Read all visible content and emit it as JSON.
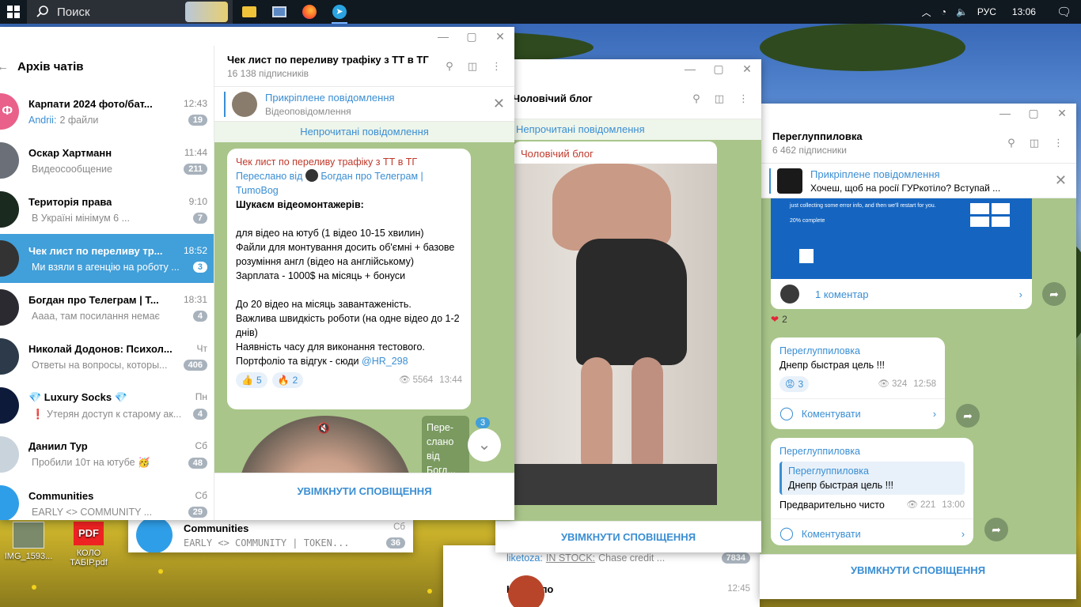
{
  "taskbar": {
    "search_label": "Поиск",
    "lang": "РУС",
    "time": "13:06"
  },
  "desktop_icons": [
    {
      "label": "IMG_1593...",
      "type": "image"
    },
    {
      "label": "КОЛО ТАБІР.pdf",
      "type": "pdf",
      "badge": "PDF"
    }
  ],
  "archive": {
    "title": "Архів чатів",
    "chats": [
      {
        "name": "Карпати 2024 фото/бат...",
        "time": "12:43",
        "preview_sender": "Andrii:",
        "preview": "2 файли",
        "badge": "19",
        "avatar_color": "#e9608a",
        "avatar_letter": "Ф"
      },
      {
        "name": "Оскар Хартманн",
        "time": "11:44",
        "preview": "Видеосообщение",
        "badge": "211",
        "avatar_color": "#6b7078"
      },
      {
        "name": "Територія права",
        "time": "9:10",
        "preview": "В Україні мінімум 6 ...",
        "badge": "7",
        "avatar_color": "#1a2a1e"
      },
      {
        "name": "Чек лист по переливу тр...",
        "time": "18:52",
        "preview": "Ми взяли в агенцію на роботу ...",
        "badge": "3",
        "avatar_color": "#333333",
        "selected": true
      },
      {
        "name": "Богдан про Телеграм | Т...",
        "time": "18:31",
        "preview": "Аааа, там посилання немає",
        "badge": "4",
        "avatar_color": "#2a2a30"
      },
      {
        "name": "Николай Додонов: Психол...",
        "time": "Чт",
        "preview": "Ответы на вопросы, которы...",
        "badge": "406",
        "avatar_color": "#2c3a4a"
      },
      {
        "name": "💎 Luxury Socks 💎",
        "time": "Пн",
        "preview": "❗ Утерян доступ к старому ак...",
        "badge": "4",
        "avatar_color": "#0d1a3a"
      },
      {
        "name": "Даниил Тур",
        "time": "Сб",
        "preview": "Пробили 10т на ютубе 🥳",
        "badge": "48",
        "avatar_color": "#c9d3dc"
      },
      {
        "name": "Communities",
        "time": "Сб",
        "preview": "EARLY <> COMMUNITY ...",
        "badge": "29",
        "avatar_color": "#2f9ee8"
      }
    ]
  },
  "bg_window": {
    "row1_name": "Communities",
    "row1_time": "Сб",
    "row1_preview": "EARLY <> COMMUNITY | TOKEN...",
    "row1_badge": "36",
    "row2_sender": "liketoza:",
    "row2_link": "IN STOCK:",
    "row2_preview": "Chase credit ...",
    "row2_badge": "7834",
    "row3_name": "Настигло",
    "row3_time": "12:45"
  },
  "window1": {
    "title": "Чек лист по переливу трафіку з ТТ в ТГ",
    "subtitle": "16 138 підписників",
    "pinned_title": "Прикріплене повідомлення",
    "pinned_text": "Відеоповідомлення",
    "unread": "Непрочитані повідомлення",
    "msg": {
      "channel": "Чек лист по переливу трафіку з ТТ в ТГ",
      "forwarded_prefix": "Переслано від",
      "forwarded_from": "Богдан про Телеграм | TumoBog",
      "heading": "Шукаєм відеомонтажерів:",
      "lines": [
        "для відео на ютуб (1 відео 10-15 хвилин)",
        "Файли для монтування досить об'ємні + базове розуміння англ (відео на англійському)",
        "Зарплата - 1000$ на місяць + бонуси",
        "До 20 відео на місяць завантаженість.",
        "Важлива швидкість роботи (на одне відео до 1-2 днів)",
        "Наявність часу для виконання тестового.",
        "Портфоліо та відгук - сюди"
      ],
      "handle": "@HR_298",
      "reactions": [
        {
          "emoji": "👍",
          "count": "5"
        },
        {
          "emoji": "🔥",
          "count": "2"
        }
      ],
      "views": "5564",
      "time": "13:44"
    },
    "fwd_stub": "Пере­слано від Богд...",
    "scroll_badge": "3",
    "bottom_button": "УВІМКНУТИ СПОВІЩЕННЯ"
  },
  "window2": {
    "title": "Чоловічий блог",
    "unread": "Непрочитані повідомлення",
    "post_channel": "Чоловічий блог",
    "bottom_button": "УВІМКНУТИ СПОВІЩЕННЯ"
  },
  "window3": {
    "title": "Переглуппиловка",
    "subtitle": "6 462 підписники",
    "pinned_title": "Прикріплене повідомлення",
    "pinned_text": "Хочеш, щоб на росії ГУРкотіло?  Вступай ...",
    "bsod_line1": "just collecting some error info, and then we'll restart for you.",
    "bsod_percent": "20% complete",
    "comments_label": "1 коментар",
    "heart_count": "2",
    "msg1": {
      "channel": "Переглуппиловка",
      "text": "Днепр быстрая цель !!!",
      "reaction_count": "3",
      "views": "324",
      "time": "12:58",
      "comment_label": "Коментувати"
    },
    "msg2": {
      "channel": "Переглуппиловка",
      "quote_channel": "Переглуппиловка",
      "quote_text": "Днепр быстрая цель !!!",
      "text": "Предварительно чисто",
      "views": "221",
      "time": "13:00",
      "comment_label": "Коментувати"
    },
    "bottom_button": "УВІМКНУТИ СПОВІЩЕННЯ"
  },
  "colors": {
    "accent": "#3a8ed3",
    "selected_row": "#419fd9",
    "chat_bg": "#a9c58a",
    "bsod": "#1565c0"
  }
}
